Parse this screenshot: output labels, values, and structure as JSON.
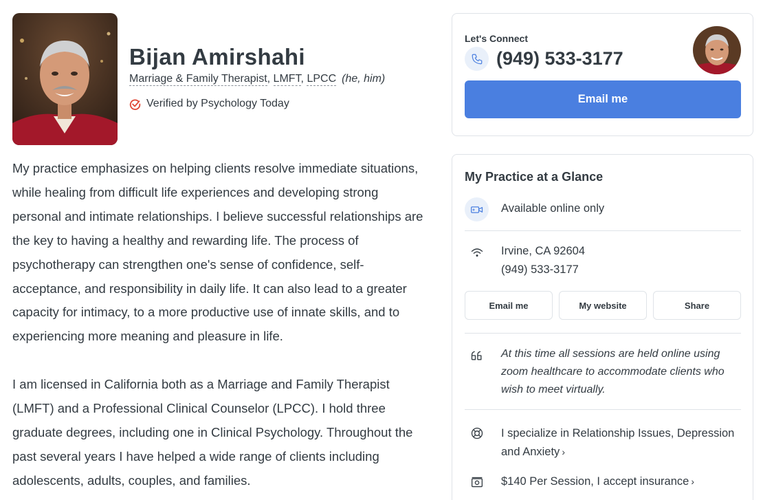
{
  "profile": {
    "name": "Bijan Amirshahi",
    "title": "Marriage & Family Therapist",
    "lmft": "LMFT",
    "lpcc": "LPCC",
    "pronouns": "(he, him)",
    "verified_text": "Verified by Psychology Today",
    "photo_alt": "Bijan Amirshahi photo"
  },
  "bio": {
    "paragraph1": "My practice emphasizes on helping clients resolve immediate situations, while healing from difficult life experiences and developing strong personal and intimate relationships. I believe successful relationships are the key to having a healthy and rewarding life. The process of psychotherapy can strengthen one's sense of confidence, self-acceptance, and responsibility in daily life. It can also lead to a greater capacity for intimacy, to a more productive use of innate skills, and to experiencing more meaning and pleasure in life.",
    "paragraph2": "I am licensed in California both as a Marriage and Family Therapist (LMFT) and a Professional Clinical Counselor (LPCC). I hold three graduate degrees, including one in Clinical Psychology. Throughout the past several years I have helped a wide range of clients including adolescents, adults, couples, and families."
  },
  "connect": {
    "title": "Let's Connect",
    "phone": "(949) 533-3177",
    "email_button": "Email me"
  },
  "glance": {
    "title": "My Practice at a Glance",
    "online": "Available online only",
    "location": "Irvine, CA 92604",
    "phone": "(949) 533-3177",
    "buttons": {
      "email": "Email me",
      "website": "My website",
      "share": "Share"
    },
    "quote": "At this time all sessions are held online using zoom healthcare to accommodate clients who wish to meet virtually.",
    "specialize": "I specialize in Relationship Issues, Depression and Anxiety",
    "fees": "$140 Per Session, I accept insurance"
  },
  "icons": {
    "phone": "phone-icon",
    "video": "video-icon",
    "wifi": "wifi-icon",
    "quote": "quote-icon",
    "specialty": "specialty-icon",
    "fees": "fees-icon",
    "verified": "verified-check-icon"
  },
  "colors": {
    "accent": "#4a7fe0",
    "icon_bg": "#e9f0fa",
    "text": "#333b42",
    "border": "#dfe3e8"
  }
}
